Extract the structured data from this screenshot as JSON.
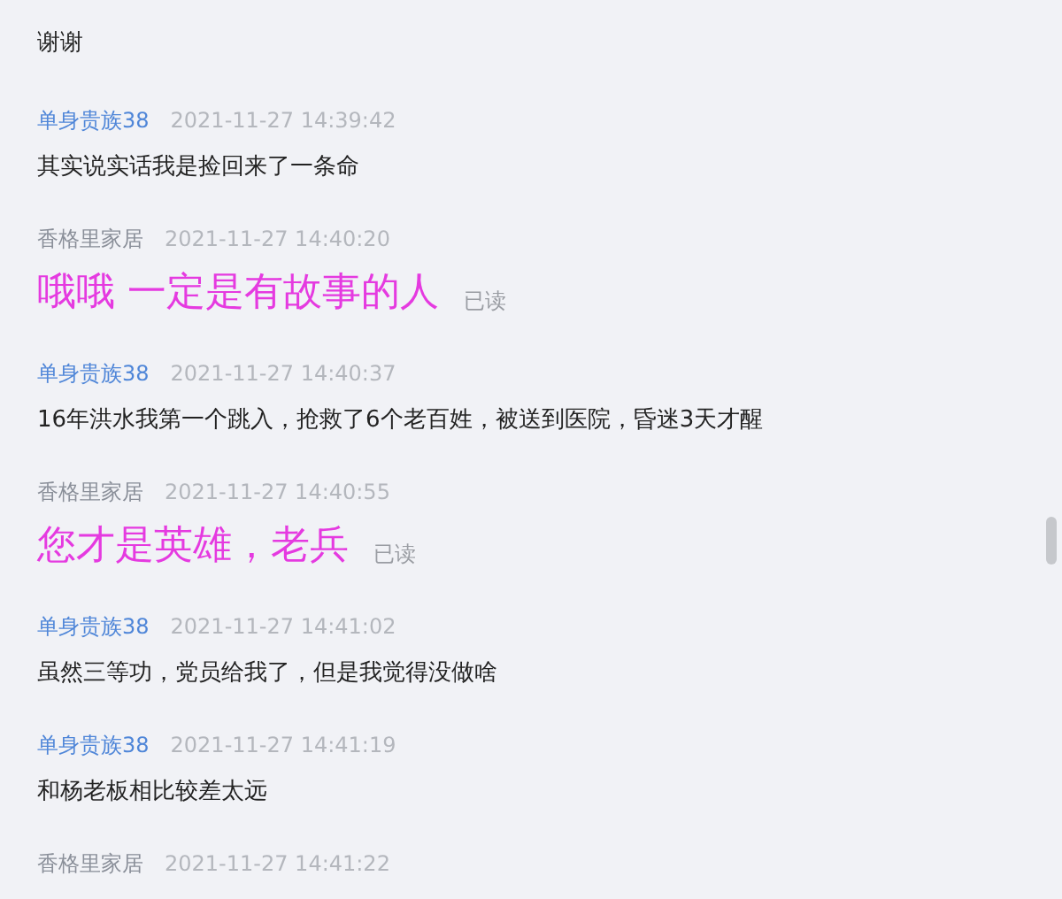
{
  "messages": [
    {
      "kind": "received",
      "text": "谢谢"
    },
    {
      "kind": "received",
      "sender": "单身贵族38",
      "time": "2021-11-27 14:39:42",
      "text": "其实说实话我是捡回来了一条命"
    },
    {
      "kind": "sent",
      "sender": "香格里家居",
      "time": "2021-11-27 14:40:20",
      "text": "哦哦 一定是有故事的人",
      "read_receipt": "已读"
    },
    {
      "kind": "received",
      "sender": "单身贵族38",
      "time": "2021-11-27 14:40:37",
      "text": "16年洪水我第一个跳入，抢救了6个老百姓，被送到医院，昏迷3天才醒"
    },
    {
      "kind": "sent",
      "sender": "香格里家居",
      "time": "2021-11-27 14:40:55",
      "text": "您才是英雄，老兵",
      "read_receipt": "已读"
    },
    {
      "kind": "received",
      "sender": "单身贵族38",
      "time": "2021-11-27 14:41:02",
      "text": "虽然三等功，党员给我了，但是我觉得没做啥"
    },
    {
      "kind": "received",
      "sender": "单身贵族38",
      "time": "2021-11-27 14:41:19",
      "text": "和杨老板相比较差太远"
    },
    {
      "kind": "sent",
      "sender": "香格里家居",
      "time": "2021-11-27 14:41:22"
    }
  ]
}
